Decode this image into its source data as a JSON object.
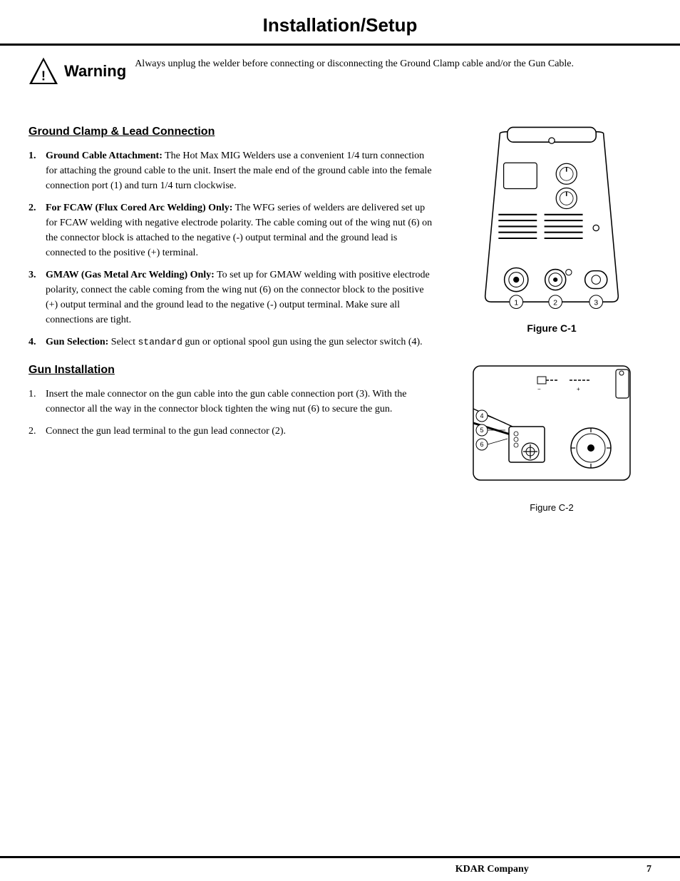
{
  "header": {
    "title": "Installation/Setup"
  },
  "warning": {
    "title": "Warning",
    "text": "Always unplug the welder before connecting or disconnecting the Ground Clamp cable and/or the Gun Cable."
  },
  "section1": {
    "heading": "Ground Clamp & Lead Connection",
    "items": [
      {
        "num": "1.",
        "bold_prefix": "Ground Cable Attachment:",
        "text": " The Hot Max MIG Welders use a convenient 1/4 turn connection for attaching the ground cable to the unit. Insert the male end of the ground cable into the female connection port (1) and turn 1/4 turn clockwise."
      },
      {
        "num": "2.",
        "bold_prefix": "For FCAW (Flux Cored Arc Welding) Only:",
        "text": " The WFG series of welders are delivered set up for FCAW welding with negative electrode polarity. The cable coming out of the wing nut (6) on the connector block is attached to the negative (-) output terminal and the ground lead is connected to the positive (+) terminal."
      },
      {
        "num": "3.",
        "bold_prefix": "GMAW (Gas Metal Arc Welding) Only:",
        "text": " To set up for GMAW welding with positive electrode polarity, connect the cable coming from the wing nut (6) on the connector block to the positive (+) output terminal and the ground lead to the negative (-) output terminal. Make sure all connections are tight."
      },
      {
        "num": "4.",
        "bold_prefix": "Gun Selection:",
        "text_before_code": " Select ",
        "code": "standard",
        "text_after_code": " gun or optional spool gun using the gun selector switch (4)."
      }
    ]
  },
  "section2": {
    "heading": "Gun Installation",
    "items": [
      {
        "num": "1.",
        "text": "Insert the male connector on the gun cable into the gun cable connection port (3). With the connector all the way in the connector block tighten the wing nut (6) to secure the gun."
      },
      {
        "num": "2.",
        "text": "Connect the gun lead terminal to the gun lead connector (2)."
      }
    ]
  },
  "figures": {
    "c1_label": "Figure C-1",
    "c2_label": "Figure C-2"
  },
  "footer": {
    "company": "KDAR Company",
    "page": "7"
  }
}
